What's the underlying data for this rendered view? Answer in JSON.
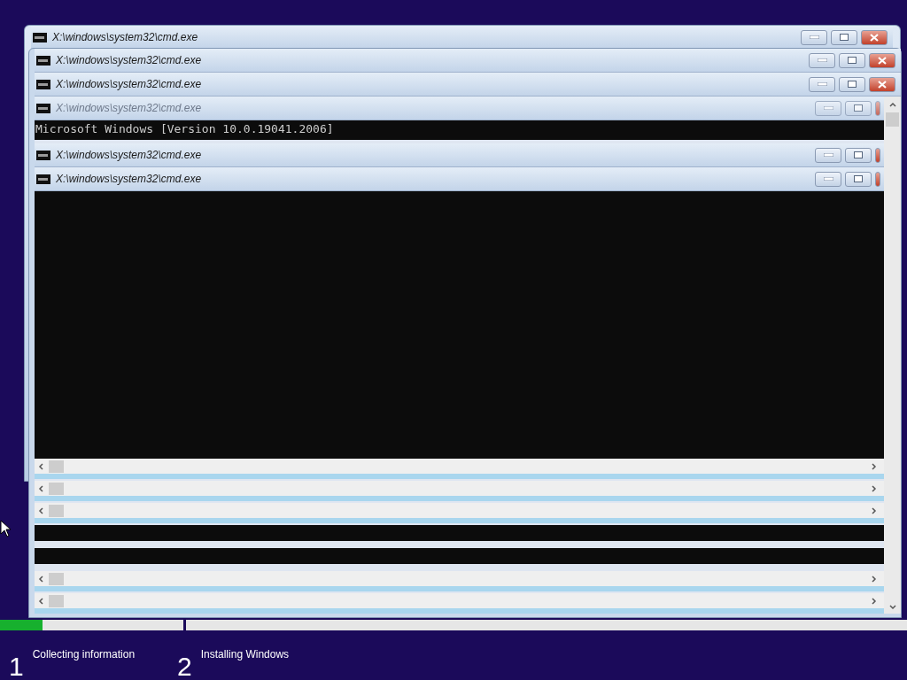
{
  "windows": [
    {
      "title": "X:\\windows\\system32\\cmd.exe",
      "faded": false
    },
    {
      "title": "X:\\windows\\system32\\cmd.exe",
      "faded": false
    },
    {
      "title": "X:\\windows\\system32\\cmd.exe",
      "faded": false
    },
    {
      "title": "X:\\windows\\system32\\cmd.exe",
      "faded": true
    },
    {
      "title": "X:\\windows\\system32\\cmd.exe",
      "faded": false
    },
    {
      "title": "X:\\windows\\system32\\cmd.exe",
      "faded": false
    }
  ],
  "console_lines": [
    "Microsoft Windows [Version 10.0.19041.2006]"
  ],
  "progress": {
    "level": 0.23
  },
  "steps": [
    {
      "number": "1",
      "label": "Collecting information"
    },
    {
      "number": "2",
      "label": "Installing Windows"
    }
  ]
}
